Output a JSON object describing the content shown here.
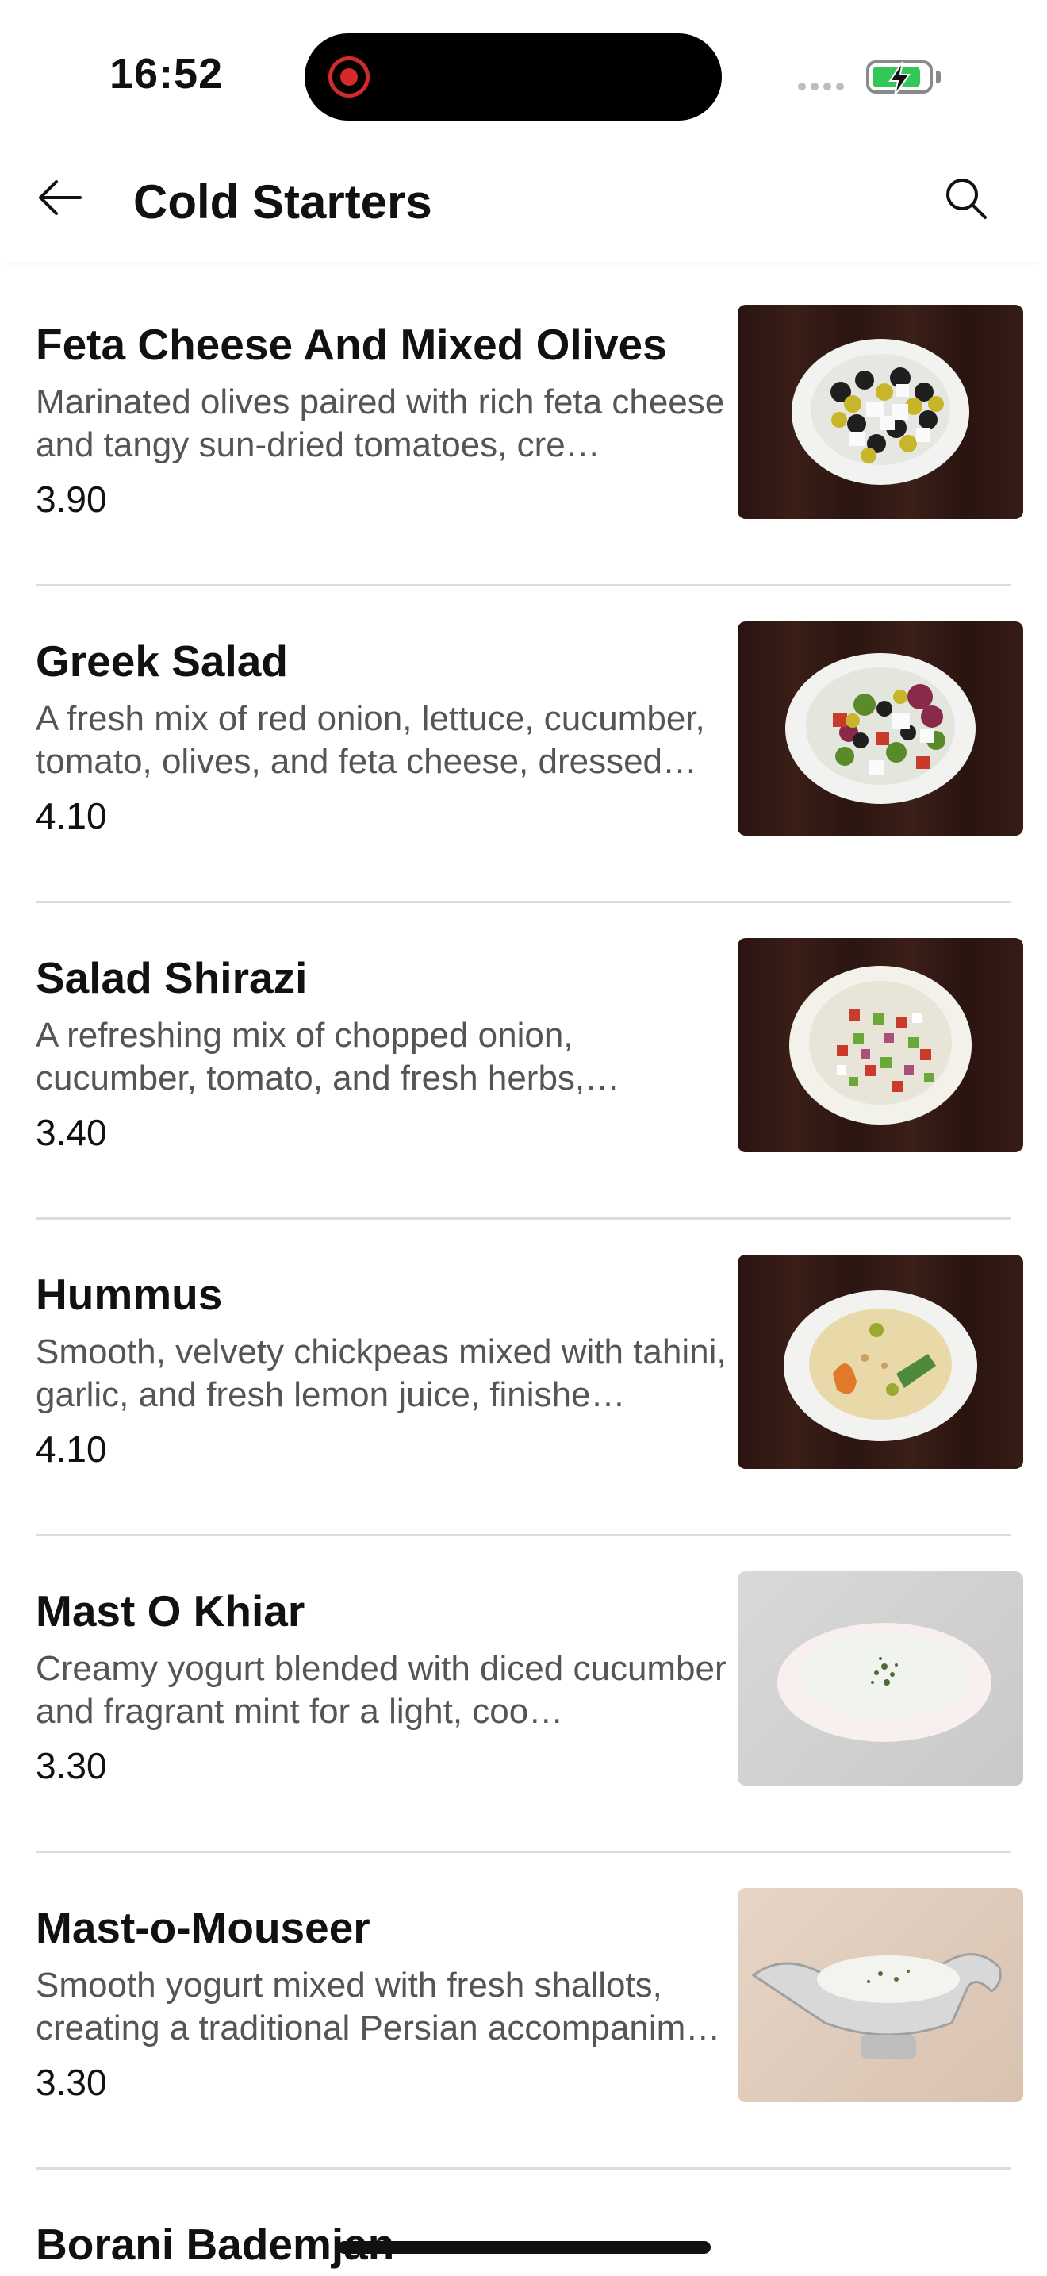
{
  "status_bar": {
    "time": "16:52",
    "battery_color": "#33c759",
    "recording_color": "#d42a2a"
  },
  "header": {
    "title": "Cold Starters",
    "back_icon": "arrow-left-icon",
    "search_icon": "search-icon"
  },
  "items": [
    {
      "name": "Feta Cheese And Mixed Olives",
      "description": "Marinated olives paired with rich feta cheese and tangy sun-dried tomatoes, cre…",
      "price": "3.90",
      "image": "olives-feta-photo"
    },
    {
      "name": "Greek Salad",
      "description": "A fresh mix of red onion, lettuce, cucumber, tomato, olives, and feta cheese, dressed wi…",
      "price": "4.10",
      "image": "greek-salad-photo"
    },
    {
      "name": "Salad Shirazi",
      "description": "A refreshing mix of chopped onion, cucumber, tomato, and fresh herbs, dresse…",
      "price": "3.40",
      "image": "salad-shirazi-photo"
    },
    {
      "name": "Hummus",
      "description": "Smooth, velvety chickpeas mixed with tahini, garlic, and fresh lemon juice, finishe…",
      "price": "4.10",
      "image": "hummus-photo"
    },
    {
      "name": "Mast O Khiar",
      "description": "Creamy yogurt blended with diced cucumber and fragrant mint for a light, coo…",
      "price": "3.30",
      "image": "mast-o-khiar-photo"
    },
    {
      "name": "Mast-o-Mouseer",
      "description": "Smooth yogurt mixed with fresh shallots, creating a traditional Persian accompanim…",
      "price": "3.30",
      "image": "mast-o-mouseer-photo"
    },
    {
      "name": "Borani Bademjan"
    }
  ]
}
